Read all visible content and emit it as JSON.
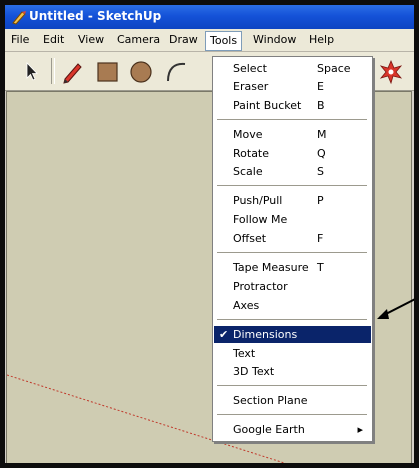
{
  "window": {
    "title": "Untitled - SketchUp"
  },
  "menubar": {
    "items": [
      "File",
      "Edit",
      "View",
      "Camera",
      "Draw",
      "Tools",
      "Window",
      "Help"
    ],
    "open_menu": "Tools"
  },
  "toolbar": {
    "tools": [
      "select-arrow-icon",
      "pencil-icon",
      "rectangle-icon",
      "circle-icon",
      "arc-icon",
      "orbit-icon",
      "axes-icon"
    ]
  },
  "tools_menu": {
    "items": [
      {
        "label": "Select",
        "shortcut": "Space"
      },
      {
        "label": "Eraser",
        "shortcut": "E"
      },
      {
        "label": "Paint Bucket",
        "shortcut": "B"
      },
      {
        "label": "Move",
        "shortcut": "M"
      },
      {
        "label": "Rotate",
        "shortcut": "Q"
      },
      {
        "label": "Scale",
        "shortcut": "S"
      },
      {
        "label": "Push/Pull",
        "shortcut": "P"
      },
      {
        "label": "Follow Me",
        "shortcut": ""
      },
      {
        "label": "Offset",
        "shortcut": "F"
      },
      {
        "label": "Tape Measure",
        "shortcut": "T"
      },
      {
        "label": "Protractor",
        "shortcut": ""
      },
      {
        "label": "Axes",
        "shortcut": ""
      },
      {
        "label": "Dimensions",
        "shortcut": "",
        "checked": true,
        "highlighted": true
      },
      {
        "label": "Text",
        "shortcut": ""
      },
      {
        "label": "3D Text",
        "shortcut": ""
      },
      {
        "label": "Section Plane",
        "shortcut": ""
      },
      {
        "label": "Google Earth",
        "shortcut": "",
        "submenu": true
      }
    ]
  },
  "colors": {
    "titlebar": "#1452d8",
    "highlight": "#0a246a",
    "canvas": "#cfccb2",
    "axis_red": "#c0392b"
  }
}
